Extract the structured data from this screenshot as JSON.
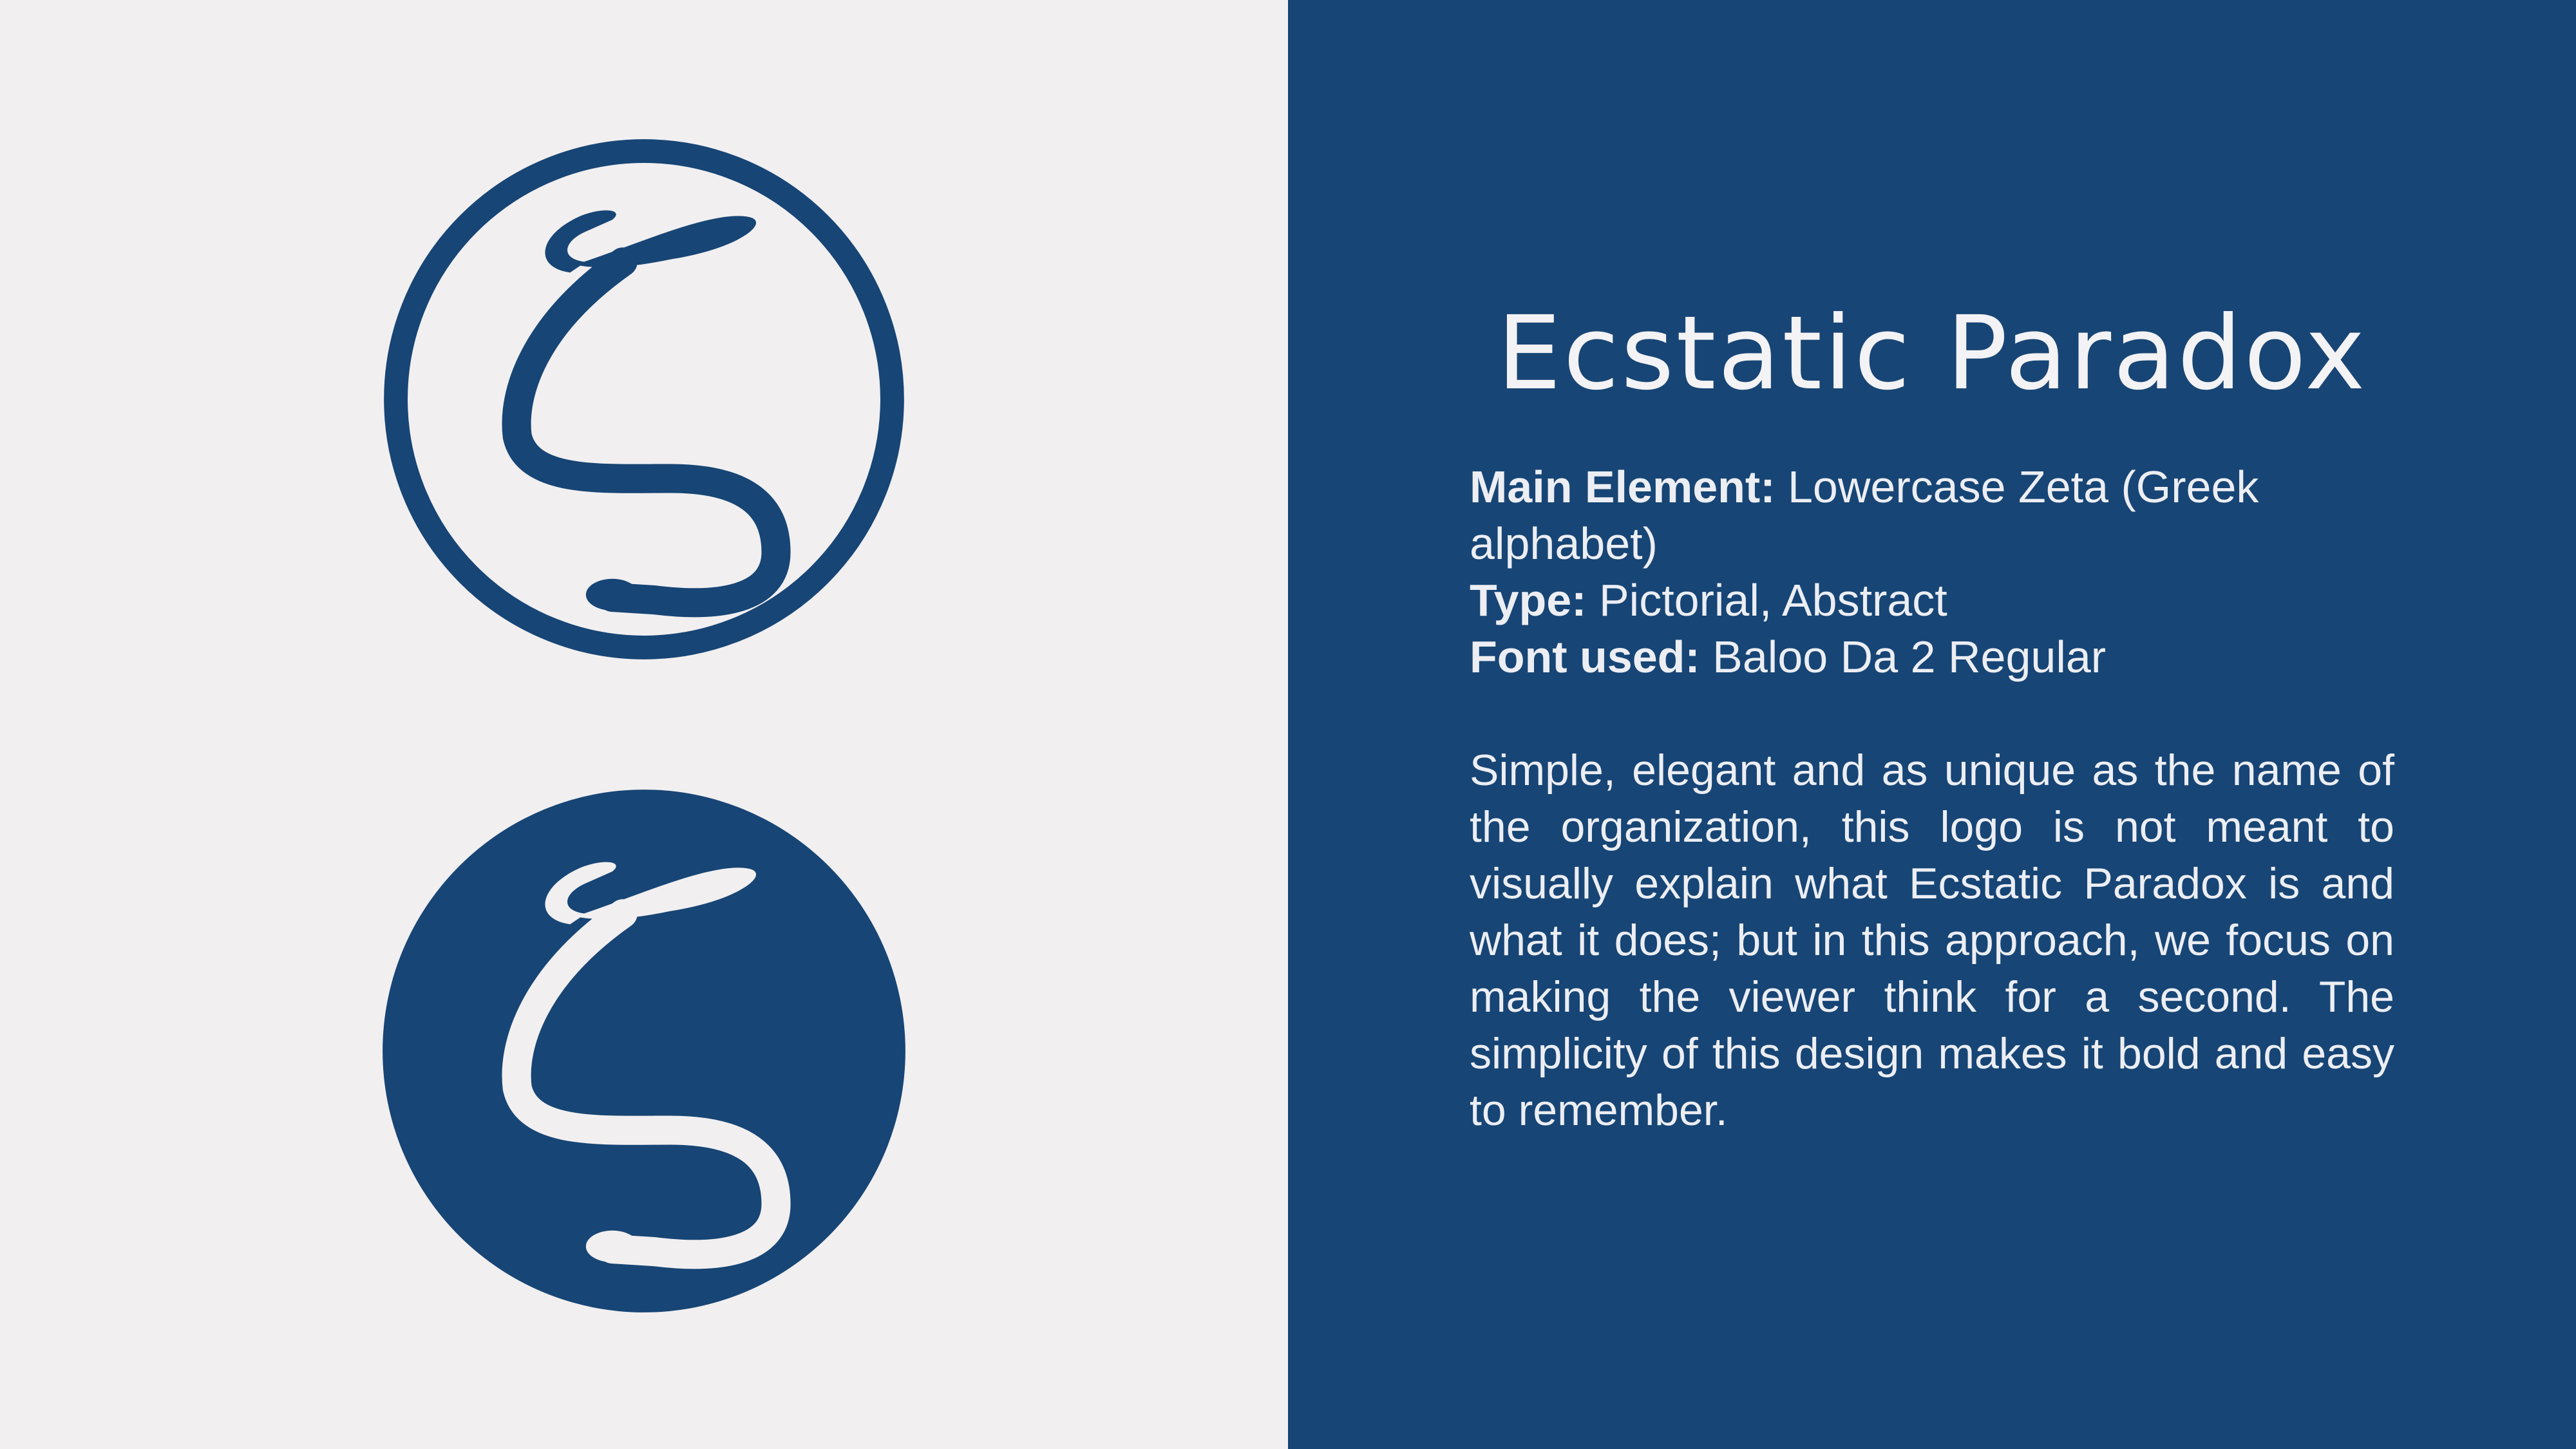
{
  "colors": {
    "brand_blue": "#174575",
    "light_background": "#f1eff0",
    "text_light": "#eceef3"
  },
  "icons": {
    "outline_logo": "zeta-outline-logo-icon",
    "filled_logo": "zeta-filled-logo-icon"
  },
  "brand": {
    "title": "Ecstatic Paradox"
  },
  "specs": {
    "main_element": {
      "label": "Main Element:",
      "value": " Lowercase Zeta (Greek alphabet)"
    },
    "type": {
      "label": "Type:",
      "value": " Pictorial, Abstract"
    },
    "font": {
      "label": "Font used:",
      "value": " Baloo Da 2 Regular"
    }
  },
  "description": "Simple, elegant and as unique as the name of the organization, this logo is not meant to visually explain what Ecstatic Paradox is and what it does; but in this approach, we focus on making the viewer think for a second. The simplicity of this design makes it bold and easy to remember."
}
